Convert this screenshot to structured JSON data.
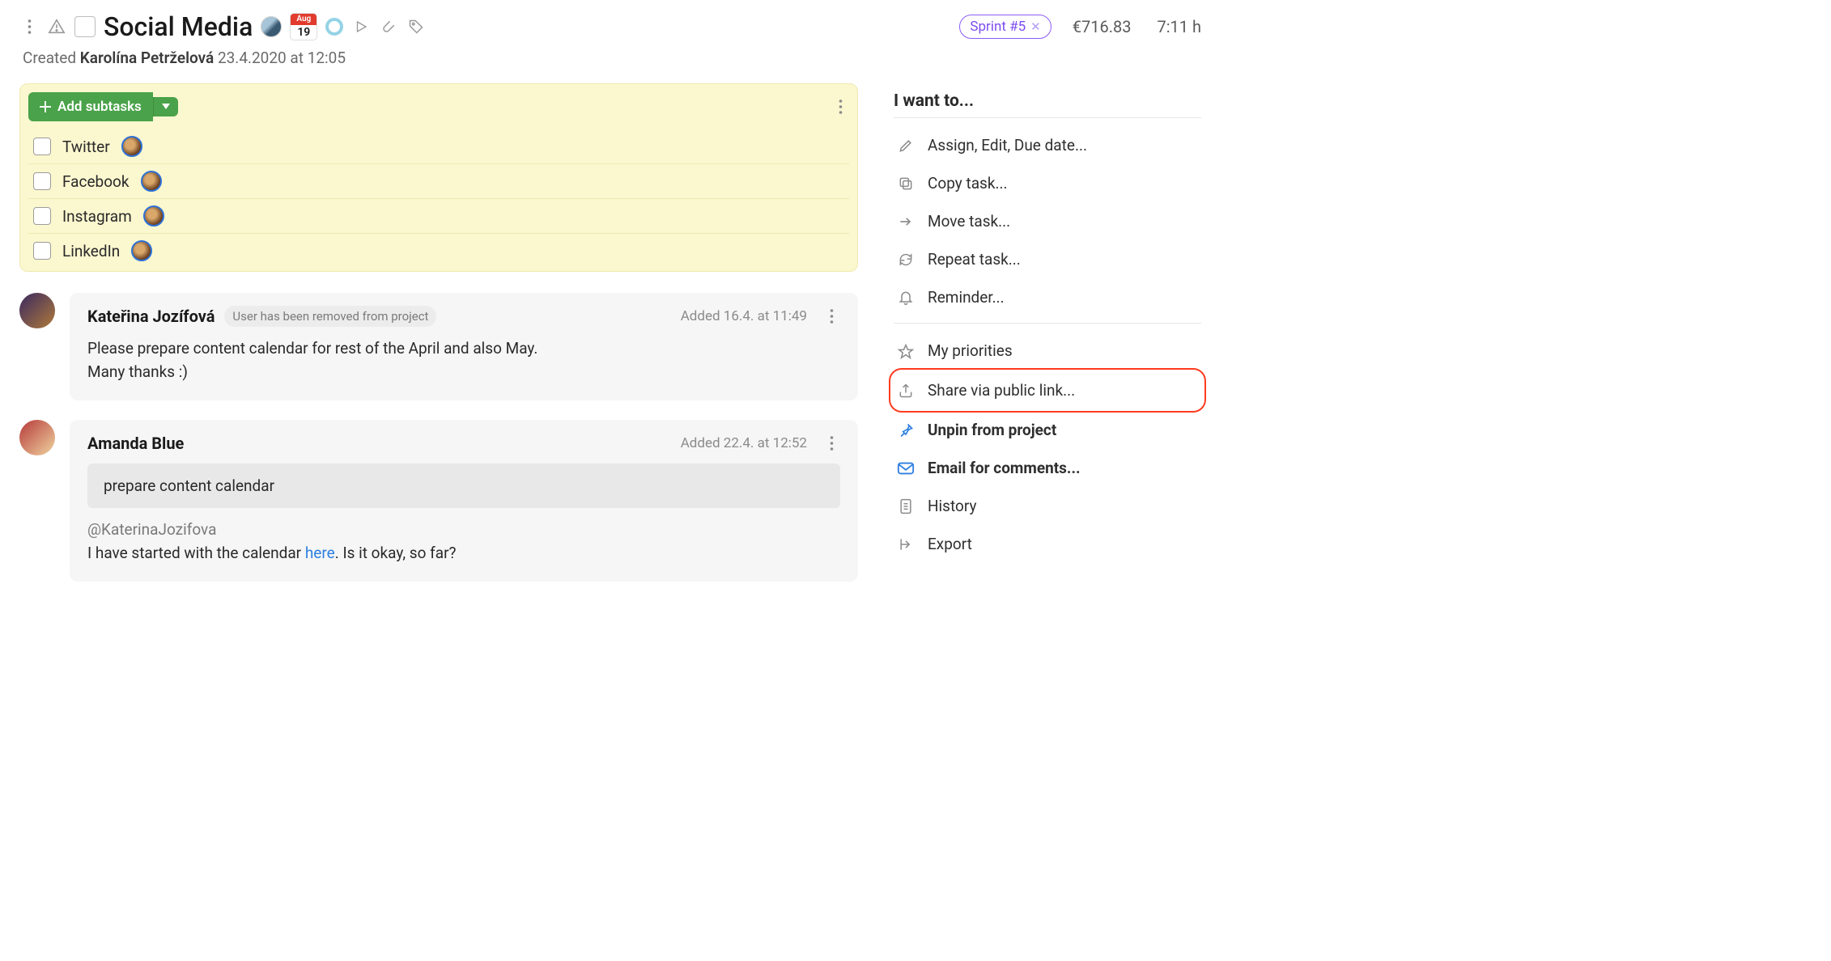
{
  "header": {
    "title": "Social Media",
    "date_badge": {
      "month": "Aug",
      "day": "19"
    },
    "sprint_label": "Sprint #5",
    "price": "€716.83",
    "duration": "7:11 h"
  },
  "subheader": {
    "created_label": "Created",
    "author": "Karolína Petrželová",
    "timestamp": "23.4.2020 at 12:05"
  },
  "subtasks": {
    "add_label": "Add subtasks",
    "items": [
      {
        "label": "Twitter"
      },
      {
        "label": "Facebook"
      },
      {
        "label": "Instagram"
      },
      {
        "label": "LinkedIn"
      }
    ]
  },
  "comments": [
    {
      "author": "Kateřina Jozífová",
      "note": "User has been removed from project",
      "time": "Added 16.4. at 11:49",
      "lines": [
        "Please prepare content calendar for rest of the April and also May.",
        "Many thanks :)"
      ]
    },
    {
      "author": "Amanda Blue",
      "time": "Added 22.4. at 12:52",
      "quote": "prepare content calendar",
      "mention": "@KaterinaJozifova",
      "text_before": "I have started with the calendar ",
      "link": "here",
      "text_after": ". Is it okay, so far?"
    }
  ],
  "side": {
    "title": "I want to...",
    "items": [
      {
        "label": "Assign, Edit, Due date...",
        "icon": "pencil"
      },
      {
        "label": "Copy task...",
        "icon": "copy"
      },
      {
        "label": "Move task...",
        "icon": "arrow-right"
      },
      {
        "label": "Repeat task...",
        "icon": "refresh"
      },
      {
        "label": "Reminder...",
        "icon": "bell"
      }
    ],
    "items2": [
      {
        "label": "My priorities",
        "icon": "star"
      },
      {
        "label": "Share via public link...",
        "icon": "share",
        "highlight": true
      },
      {
        "label": "Unpin from project",
        "icon": "pin",
        "bold": true
      },
      {
        "label": "Email for comments...",
        "icon": "mail",
        "bold": true
      },
      {
        "label": "History",
        "icon": "doc"
      },
      {
        "label": "Export",
        "icon": "export"
      }
    ]
  }
}
